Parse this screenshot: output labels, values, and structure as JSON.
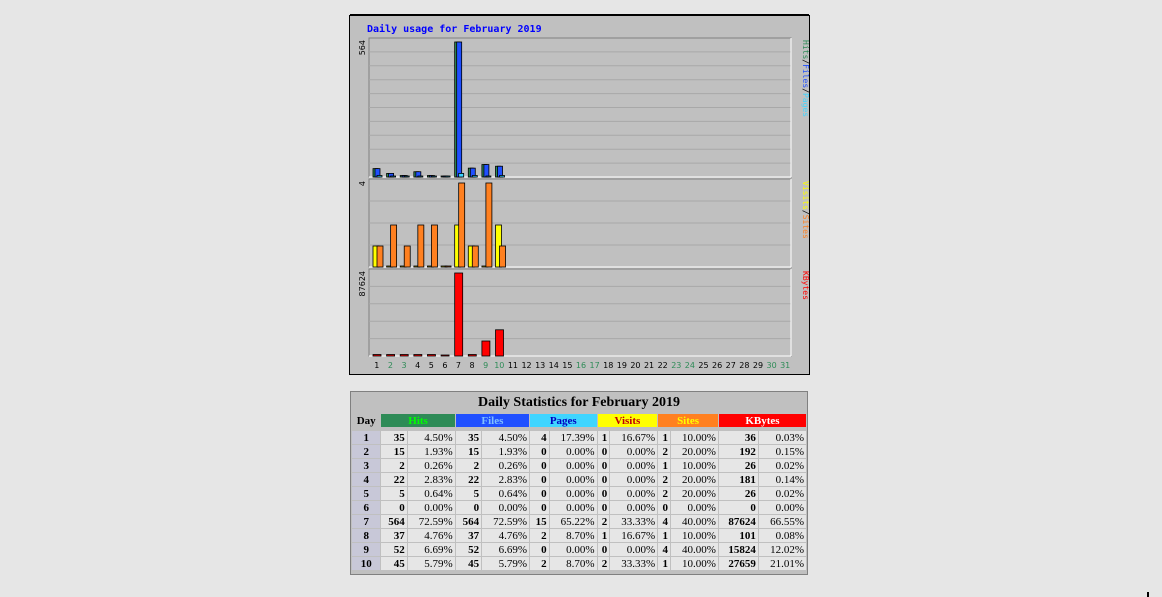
{
  "chart_data": {
    "type": "bar",
    "title": "Daily usage for February 2019",
    "categories": [
      "1",
      "2",
      "3",
      "4",
      "5",
      "6",
      "7",
      "8",
      "9",
      "10",
      "11",
      "12",
      "13",
      "14",
      "15",
      "16",
      "17",
      "18",
      "19",
      "20",
      "21",
      "22",
      "23",
      "24",
      "25",
      "26",
      "27",
      "28",
      "29",
      "30",
      "31"
    ],
    "weekend_days": [
      2,
      3,
      9,
      10,
      16,
      17,
      23,
      24,
      30,
      31
    ],
    "panels": [
      {
        "name": "hits-files-pages",
        "scale_label": "564",
        "ymax": 564,
        "legend": [
          "Pages",
          "/",
          "Files",
          "/",
          "Hits"
        ],
        "legend_colors": [
          "#3fd5ff",
          "#000000",
          "#2050ff",
          "#000000",
          "#2e8b57"
        ],
        "series": [
          {
            "name": "Hits",
            "color": "#2e8b57",
            "values": [
              35,
              15,
              2,
              22,
              5,
              0,
              564,
              37,
              52,
              45
            ]
          },
          {
            "name": "Files",
            "color": "#2050ff",
            "values": [
              35,
              15,
              2,
              22,
              5,
              0,
              564,
              37,
              52,
              45
            ]
          },
          {
            "name": "Pages",
            "color": "#3fd5ff",
            "values": [
              4,
              0,
              0,
              0,
              0,
              0,
              15,
              2,
              0,
              2
            ]
          }
        ]
      },
      {
        "name": "visits-sites",
        "scale_label": "4",
        "ymax": 4,
        "legend": [
          "Sites",
          "/",
          "Visits"
        ],
        "legend_colors": [
          "#ff8020",
          "#000000",
          "#ffff00"
        ],
        "series": [
          {
            "name": "Visits",
            "color": "#ffff00",
            "values": [
              1,
              0,
              0,
              0,
              0,
              0,
              2,
              1,
              0,
              2
            ]
          },
          {
            "name": "Sites",
            "color": "#ff8020",
            "values": [
              1,
              2,
              1,
              2,
              2,
              0,
              4,
              1,
              4,
              1
            ]
          }
        ]
      },
      {
        "name": "kbytes",
        "scale_label": "87624",
        "ymax": 87624,
        "legend": [
          "KBytes"
        ],
        "legend_colors": [
          "#ff0000"
        ],
        "series": [
          {
            "name": "KBytes",
            "color": "#ff0000",
            "values": [
              36,
              192,
              26,
              181,
              26,
              0,
              87624,
              101,
              15824,
              27659
            ]
          }
        ]
      }
    ]
  },
  "stats": {
    "title": "Daily Statistics for February 2019",
    "headers": {
      "day": "Day",
      "hits": "Hits",
      "files": "Files",
      "pages": "Pages",
      "visits": "Visits",
      "sites": "Sites",
      "kbytes": "KBytes"
    },
    "rows": [
      [
        "1",
        "35",
        "4.50%",
        "35",
        "4.50%",
        "4",
        "17.39%",
        "1",
        "16.67%",
        "1",
        "10.00%",
        "36",
        "0.03%"
      ],
      [
        "2",
        "15",
        "1.93%",
        "15",
        "1.93%",
        "0",
        "0.00%",
        "0",
        "0.00%",
        "2",
        "20.00%",
        "192",
        "0.15%"
      ],
      [
        "3",
        "2",
        "0.26%",
        "2",
        "0.26%",
        "0",
        "0.00%",
        "0",
        "0.00%",
        "1",
        "10.00%",
        "26",
        "0.02%"
      ],
      [
        "4",
        "22",
        "2.83%",
        "22",
        "2.83%",
        "0",
        "0.00%",
        "0",
        "0.00%",
        "2",
        "20.00%",
        "181",
        "0.14%"
      ],
      [
        "5",
        "5",
        "0.64%",
        "5",
        "0.64%",
        "0",
        "0.00%",
        "0",
        "0.00%",
        "2",
        "20.00%",
        "26",
        "0.02%"
      ],
      [
        "6",
        "0",
        "0.00%",
        "0",
        "0.00%",
        "0",
        "0.00%",
        "0",
        "0.00%",
        "0",
        "0.00%",
        "0",
        "0.00%"
      ],
      [
        "7",
        "564",
        "72.59%",
        "564",
        "72.59%",
        "15",
        "65.22%",
        "2",
        "33.33%",
        "4",
        "40.00%",
        "87624",
        "66.55%"
      ],
      [
        "8",
        "37",
        "4.76%",
        "37",
        "4.76%",
        "2",
        "8.70%",
        "1",
        "16.67%",
        "1",
        "10.00%",
        "101",
        "0.08%"
      ],
      [
        "9",
        "52",
        "6.69%",
        "52",
        "6.69%",
        "0",
        "0.00%",
        "0",
        "0.00%",
        "4",
        "40.00%",
        "15824",
        "12.02%"
      ],
      [
        "10",
        "45",
        "5.79%",
        "45",
        "5.79%",
        "2",
        "8.70%",
        "2",
        "33.33%",
        "1",
        "10.00%",
        "27659",
        "21.01%"
      ]
    ]
  }
}
